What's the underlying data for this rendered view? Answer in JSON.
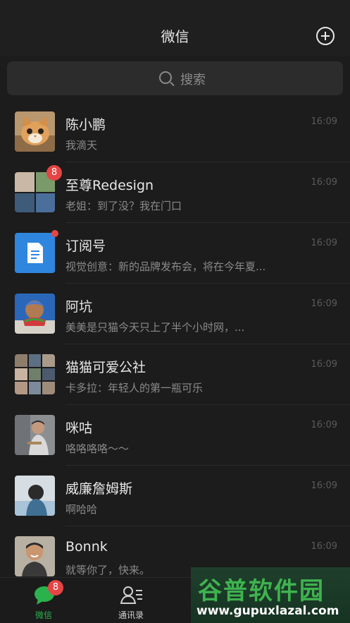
{
  "header": {
    "title": "微信",
    "add_icon": "plus-circle-icon"
  },
  "search": {
    "placeholder": "搜索",
    "icon": "search-icon"
  },
  "chats": [
    {
      "name": "陈小鹏",
      "preview": "我滴天",
      "time": "16:09",
      "avatar": "cat-photo"
    },
    {
      "name": "至尊Redesign",
      "preview": "老姐：到了没？我在门口",
      "time": "16:09",
      "badge": "8",
      "avatar": "group-4"
    },
    {
      "name": "订阅号",
      "preview": "视觉创意：新的品牌发布会，将在今年夏...",
      "time": "16:09",
      "avatar": "subscription-icon",
      "dot": true
    },
    {
      "name": "阿坑",
      "preview": "美美是只猫今天只上了半个小时网，...",
      "time": "16:09",
      "avatar": "watermelon-photo"
    },
    {
      "name": "猫猫可爱公社",
      "preview": "卡多拉：年轻人的第一瓶可乐",
      "time": "16:09",
      "avatar": "group-9"
    },
    {
      "name": "咪咕",
      "preview": "咯咯咯咯～～",
      "time": "16:09",
      "avatar": "man-photo"
    },
    {
      "name": "威廉詹姆斯",
      "preview": "啊哈哈",
      "time": "16:09",
      "avatar": "girl-photo"
    },
    {
      "name": "Bonnk",
      "preview": "就等你了，快来。",
      "time": "16:09",
      "avatar": "smiling-man-photo"
    }
  ],
  "tabbar": {
    "items": [
      {
        "label": "微信",
        "icon": "chat-bubble-icon",
        "badge": "8",
        "active": true
      },
      {
        "label": "通讯录",
        "icon": "contacts-icon",
        "active": false
      }
    ]
  },
  "watermark": {
    "title": "谷普软件园",
    "url": "www.gupuxlazal.com"
  },
  "colors": {
    "accent": "#2bb24c",
    "badge": "#e54545",
    "background": "#1c1c1c"
  }
}
